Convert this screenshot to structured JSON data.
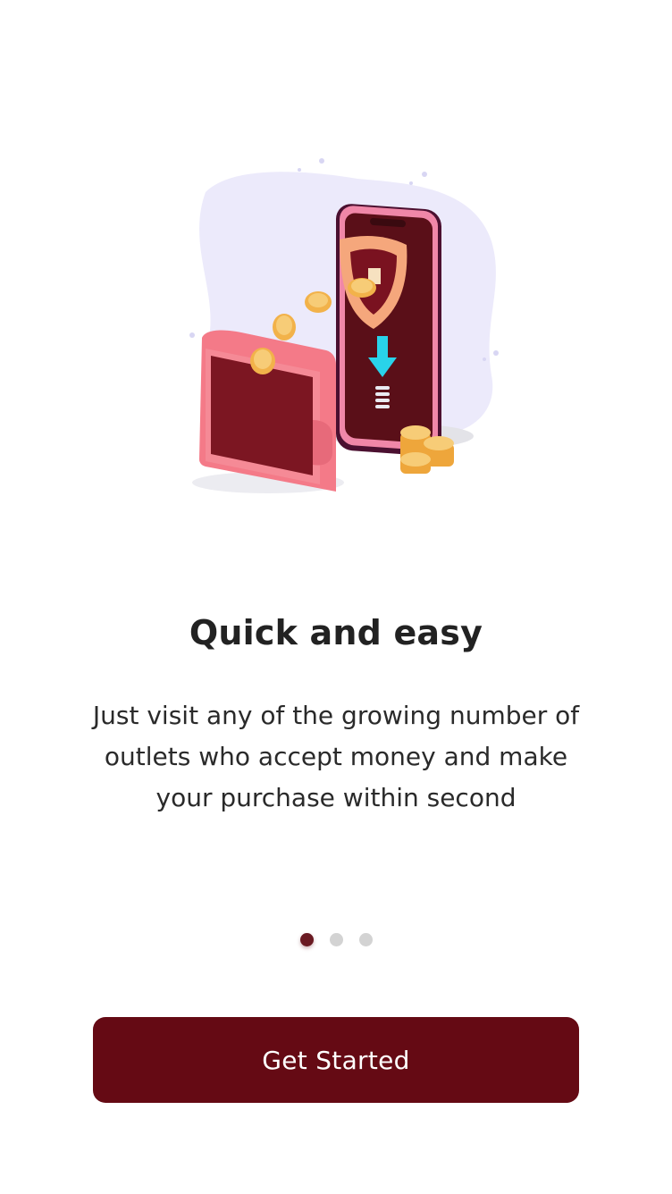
{
  "onboarding": {
    "title": "Quick and easy",
    "description": "Just visit any of the growing number of outlets who accept money and make your purchase within second",
    "pagination": {
      "total": 3,
      "current": 1
    },
    "cta_label": "Get Started"
  },
  "colors": {
    "brand": "#650a14",
    "active_dot": "#6a1a22",
    "inactive_dot": "#d3d3d3",
    "blob": "#eceafb",
    "coin": "#f2b24a",
    "arrow": "#29d3ea",
    "wallet": "#f47a88"
  },
  "illustration": {
    "icons": [
      "smartphone-icon",
      "shield-icon",
      "wallet-icon",
      "coin-icon",
      "download-arrow-icon"
    ]
  }
}
